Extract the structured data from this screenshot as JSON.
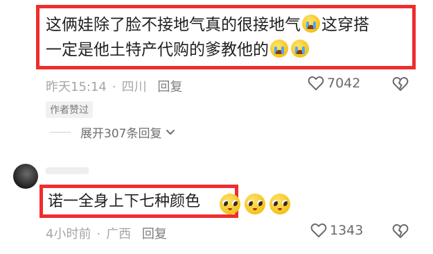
{
  "comment1": {
    "line1": "这俩娃除了脸不接地气真的很接地气",
    "line1_after_emoji": "这穿搭",
    "line2": "一定是他土特产代购的爹教他的",
    "emoji": "loudly-crying-face",
    "time": "昨天15:14",
    "separator": "·",
    "location": "四川",
    "reply_label": "回复",
    "likes": "7042",
    "author_liked_badge": "作者赞过",
    "expand_replies": "展开307条回复"
  },
  "comment2": {
    "text": "诺一全身上下七种颜色",
    "emoji": "pleading-face",
    "time": "4小时前",
    "separator": "·",
    "location": "广西",
    "reply_label": "回复",
    "likes": "1343"
  },
  "colors": {
    "highlight_border": "#ef2d2d",
    "meta_text": "#a6a6a6"
  }
}
